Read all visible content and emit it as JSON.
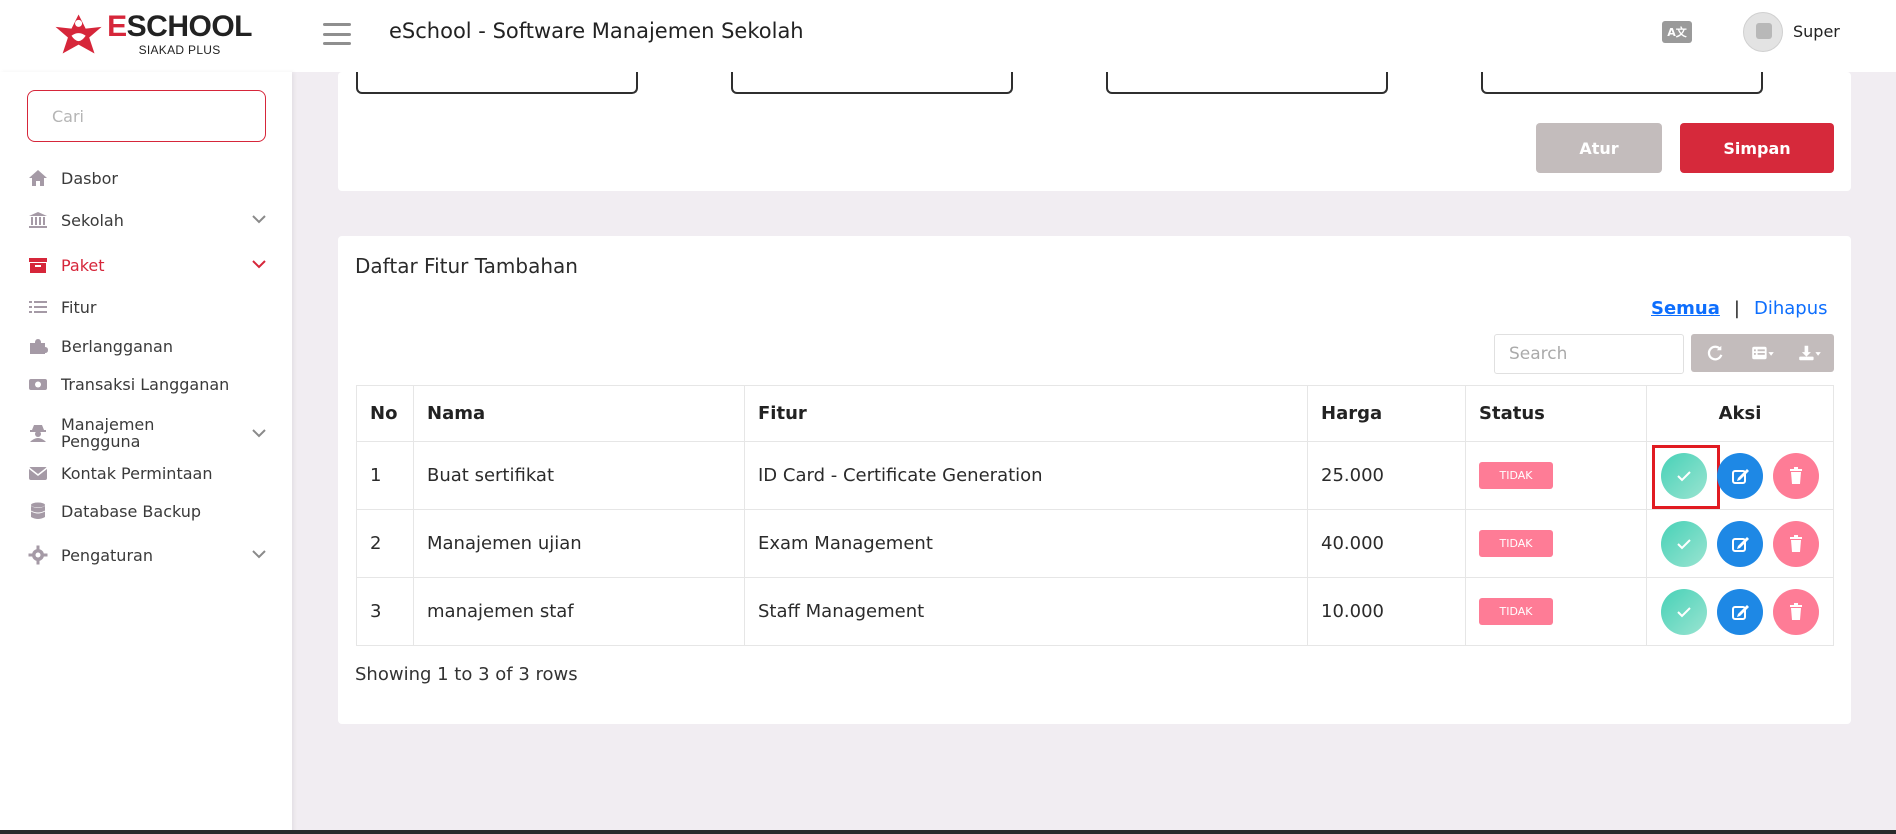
{
  "header": {
    "logo_title_first": "E",
    "logo_title_rest": "SCHOOL",
    "logo_sub": "SIAKAD PLUS",
    "app_title": "eSchool - Software Manajemen Sekolah",
    "user_name": "Super",
    "translate_icon": "translate-icon"
  },
  "sidebar": {
    "search_placeholder": "Cari",
    "items": [
      {
        "label": "Dasbor",
        "icon": "home-icon"
      },
      {
        "label": "Sekolah",
        "icon": "school-building-icon"
      },
      {
        "label": "Paket",
        "icon": "archive-box-icon"
      },
      {
        "label": "Fitur",
        "icon": "list-icon"
      },
      {
        "label": "Berlangganan",
        "icon": "puzzle-icon"
      },
      {
        "label": "Transaksi Langganan",
        "icon": "money-icon"
      },
      {
        "label": "Manajemen Pengguna",
        "icon": "user-secret-icon"
      },
      {
        "label": "Kontak Permintaan",
        "icon": "envelope-icon"
      },
      {
        "label": "Database Backup",
        "icon": "database-icon"
      },
      {
        "label": "Pengaturan",
        "icon": "gear-icon"
      }
    ]
  },
  "top_card": {
    "atur_label": "Atur",
    "simpan_label": "Simpan"
  },
  "list": {
    "title": "Daftar Fitur Tambahan",
    "filter_all": "Semua",
    "filter_sep": "|",
    "filter_deleted": "Dihapus",
    "search_placeholder": "Search",
    "columns": [
      "No",
      "Nama",
      "Fitur",
      "Harga",
      "Status",
      "Aksi"
    ],
    "rows": [
      {
        "no": "1",
        "nama": "Buat sertifikat",
        "fitur": "ID Card - Certificate Generation",
        "harga": "25.000",
        "status": "TIDAK"
      },
      {
        "no": "2",
        "nama": "Manajemen ujian",
        "fitur": "Exam Management",
        "harga": "40.000",
        "status": "TIDAK"
      },
      {
        "no": "3",
        "nama": "manajemen staf",
        "fitur": "Staff Management",
        "harga": "10.000",
        "status": "TIDAK"
      }
    ],
    "footer": "Showing 1 to 3 of 3 rows"
  },
  "colors": {
    "accent": "#d6263a",
    "status_badge": "#fe7c96",
    "edit_button": "#1e88e5",
    "approve_button": "#47d1b7",
    "link": "#0d6efd"
  }
}
